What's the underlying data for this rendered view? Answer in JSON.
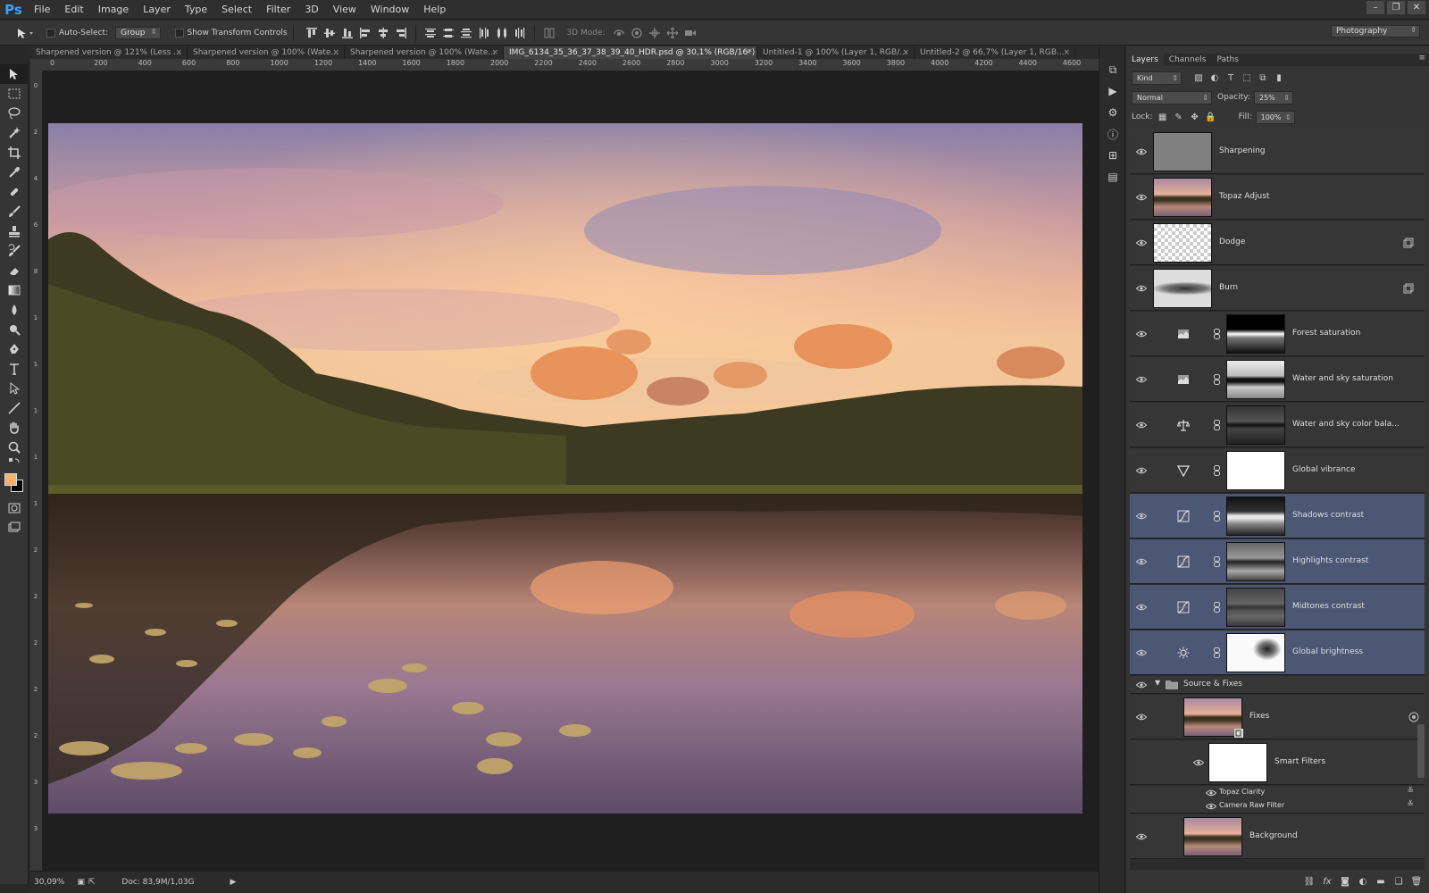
{
  "app": {
    "logo": "Ps"
  },
  "menu": [
    "File",
    "Edit",
    "Image",
    "Layer",
    "Type",
    "Select",
    "Filter",
    "3D",
    "View",
    "Window",
    "Help"
  ],
  "window_controls": [
    "–",
    "❐",
    "✕"
  ],
  "options": {
    "auto_select_label": "Auto-Select:",
    "auto_select_value": "Group",
    "transform_label": "Show Transform Controls",
    "mode3d_label": "3D Mode:",
    "workspace": "Photography"
  },
  "tabs": [
    {
      "label": "Sharpened version @ 121% (Less ...",
      "close": "×"
    },
    {
      "label": "Sharpened version @ 100% (Wate...",
      "close": "×"
    },
    {
      "label": "Sharpened version @ 100% (Wate...",
      "close": "×"
    },
    {
      "label": "IMG_6134_35_36_37_38_39_40_HDR.psd @ 30,1% (RGB/16*) *",
      "close": "×"
    },
    {
      "label": "Untitled-1 @ 100% (Layer 1, RGB/...",
      "close": "×"
    },
    {
      "label": "Untitled-2 @ 66,7% (Layer 1, RGB...",
      "close": "×"
    }
  ],
  "ruler": {
    "h_ticks": [
      "0",
      "200",
      "400",
      "600",
      "800",
      "1000",
      "1200",
      "1400",
      "1600",
      "1800",
      "2000",
      "2200",
      "2400",
      "2600",
      "2800",
      "3000",
      "3200",
      "3400",
      "3600",
      "3800",
      "4000",
      "4200",
      "4400",
      "4600"
    ],
    "v_ticks": [
      "0",
      "2",
      "4",
      "6",
      "8",
      "1",
      "1",
      "1",
      "1",
      "1",
      "2",
      "2",
      "2",
      "2",
      "2",
      "3",
      "3"
    ]
  },
  "status": {
    "zoom": "30,09%",
    "doc": "Doc: 83,9M/1,03G"
  },
  "panel": {
    "tabs": [
      "Layers",
      "Channels",
      "Paths"
    ],
    "menu_icon": "≡",
    "kind": "Kind",
    "blend_mode": "Normal",
    "opacity_label": "Opacity:",
    "opacity_value": "25%",
    "lock_label": "Lock:",
    "fill_label": "Fill:",
    "fill_value": "100%"
  },
  "layers": [
    {
      "name": "Sharpening",
      "thumb": "gray"
    },
    {
      "name": "Topaz Adjust",
      "thumb": "photo"
    },
    {
      "name": "Dodge",
      "thumb": "checker"
    },
    {
      "name": "Burn",
      "thumb": "burn"
    },
    {
      "name": "Forest saturation",
      "adj": "hue-sat",
      "mask": "forest"
    },
    {
      "name": "Water and sky saturation",
      "adj": "hue-sat",
      "mask": "watersky"
    },
    {
      "name": "Water and sky color bala...",
      "adj": "color-balance",
      "mask": "dark"
    },
    {
      "name": "Global vibrance",
      "adj": "vibrance",
      "mask": "white"
    },
    {
      "name": "Shadows contrast",
      "adj": "curves",
      "mask": "forest",
      "selected": true
    },
    {
      "name": "Highlights contrast",
      "adj": "curves",
      "mask": "gray",
      "selected": true
    },
    {
      "name": "Midtones contrast",
      "adj": "curves",
      "mask": "midgray",
      "selected": true
    },
    {
      "name": "Global brightness",
      "adj": "brightness",
      "mask": "bright",
      "selected": true
    }
  ],
  "group": {
    "name": "Source & Fixes"
  },
  "fixes": {
    "name": "Fixes"
  },
  "smart_filters": {
    "name": "Smart Filters",
    "items": [
      "Topaz Clarity",
      "Camera Raw Filter"
    ]
  },
  "background_layer": {
    "name": "Background"
  }
}
